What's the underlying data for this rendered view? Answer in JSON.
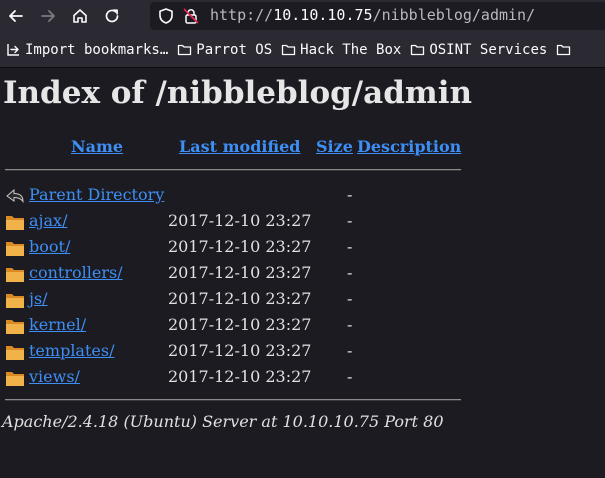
{
  "browser": {
    "url_prefix": "http://",
    "url_host": "10.10.10.75",
    "url_path": "/nibbleblog/admin/",
    "bookmarks": [
      {
        "label": "Import bookmarks…",
        "icon": "import-icon"
      },
      {
        "label": "Parrot OS",
        "icon": "folder-icon"
      },
      {
        "label": "Hack The Box",
        "icon": "folder-icon"
      },
      {
        "label": "OSINT Services",
        "icon": "folder-icon"
      }
    ]
  },
  "page": {
    "title": "Index of /nibbleblog/admin",
    "columns": {
      "name": "Name",
      "last_modified": "Last modified",
      "size": "Size",
      "description": "Description"
    },
    "parent": {
      "name": "Parent Directory",
      "size": "-"
    },
    "rows": [
      {
        "name": "ajax/",
        "date": "2017-12-10 23:27",
        "size": "-"
      },
      {
        "name": "boot/",
        "date": "2017-12-10 23:27",
        "size": "-"
      },
      {
        "name": "controllers/",
        "date": "2017-12-10 23:27",
        "size": "-"
      },
      {
        "name": "js/",
        "date": "2017-12-10 23:27",
        "size": "-"
      },
      {
        "name": "kernel/",
        "date": "2017-12-10 23:27",
        "size": "-"
      },
      {
        "name": "templates/",
        "date": "2017-12-10 23:27",
        "size": "-"
      },
      {
        "name": "views/",
        "date": "2017-12-10 23:27",
        "size": "-"
      }
    ],
    "footer": "Apache/2.4.18 (Ubuntu) Server at 10.10.10.75 Port 80"
  },
  "colors": {
    "link": "#3d8ff5",
    "background": "#1c1b22",
    "toolbar": "#2b2a33",
    "folder": "#e8a33c"
  }
}
